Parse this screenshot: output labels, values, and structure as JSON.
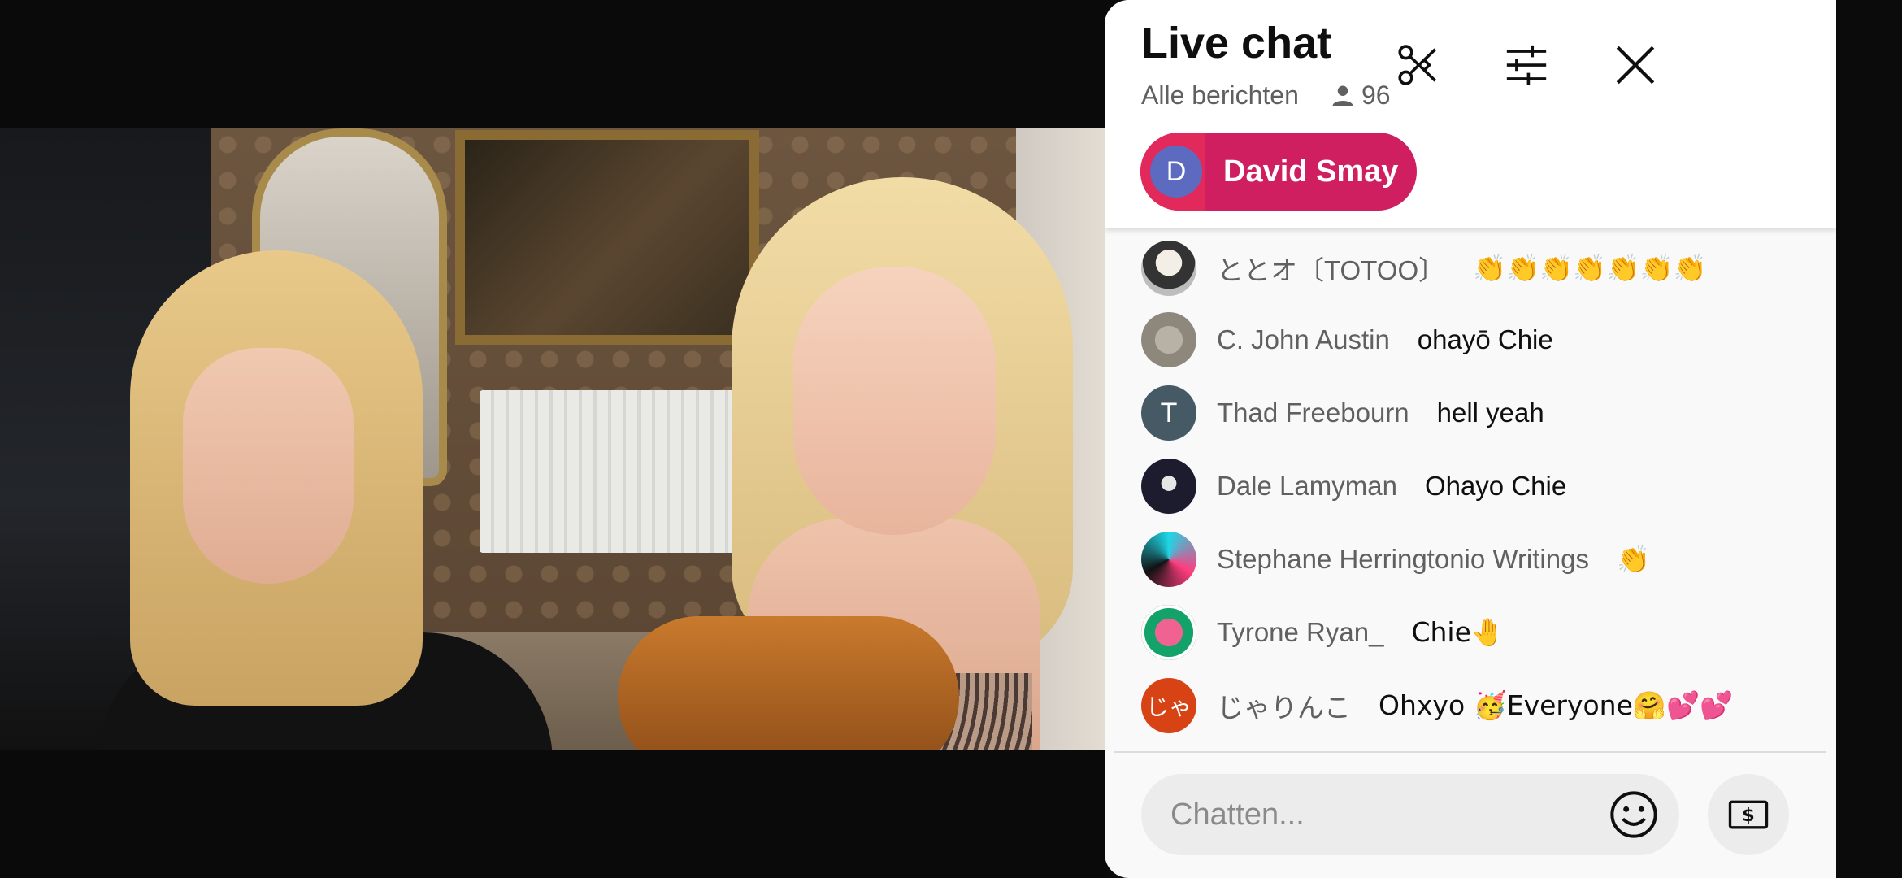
{
  "chat": {
    "title": "Live chat",
    "mode": "Alle berichten",
    "viewer_count": "96",
    "pinned": {
      "avatar_letter": "D",
      "name": "David Smay",
      "color": "#cf1f60"
    },
    "messages": [
      {
        "author": "ととオ〔TOTOO〕",
        "text": "👏👏👏👏👏👏👏",
        "avatar": "image-avatar"
      },
      {
        "author": "C. John Austin",
        "text": "ohayō Chie",
        "avatar": "image-avatar"
      },
      {
        "author": "Thad Freebourn",
        "text": "hell yeah",
        "avatar_letter": "T"
      },
      {
        "author": "Dale Lamyman",
        "text": "Ohayo Chie",
        "avatar": "image-avatar"
      },
      {
        "author": "Stephane Herringtonio Writings",
        "text": "👏",
        "avatar": "image-avatar"
      },
      {
        "author": "Tyrone Ryan_",
        "text": "Chie🤚",
        "avatar": "image-avatar"
      },
      {
        "author": "じゃりんこ",
        "text": "Ohxyo 🥳Everyone🤗💕💕",
        "avatar_letter": "じゃ"
      }
    ],
    "input_placeholder": "Chatten..."
  },
  "icons": {
    "header": [
      "scissors-icon",
      "filter-sliders-icon",
      "close-icon"
    ],
    "viewer": "person-icon",
    "input": [
      "emoji-icon",
      "superchat-dollar-icon"
    ]
  },
  "colors": {
    "accent": "#cf1f60",
    "panel_bg": "#f9f9f9",
    "author_text": "#606060"
  }
}
